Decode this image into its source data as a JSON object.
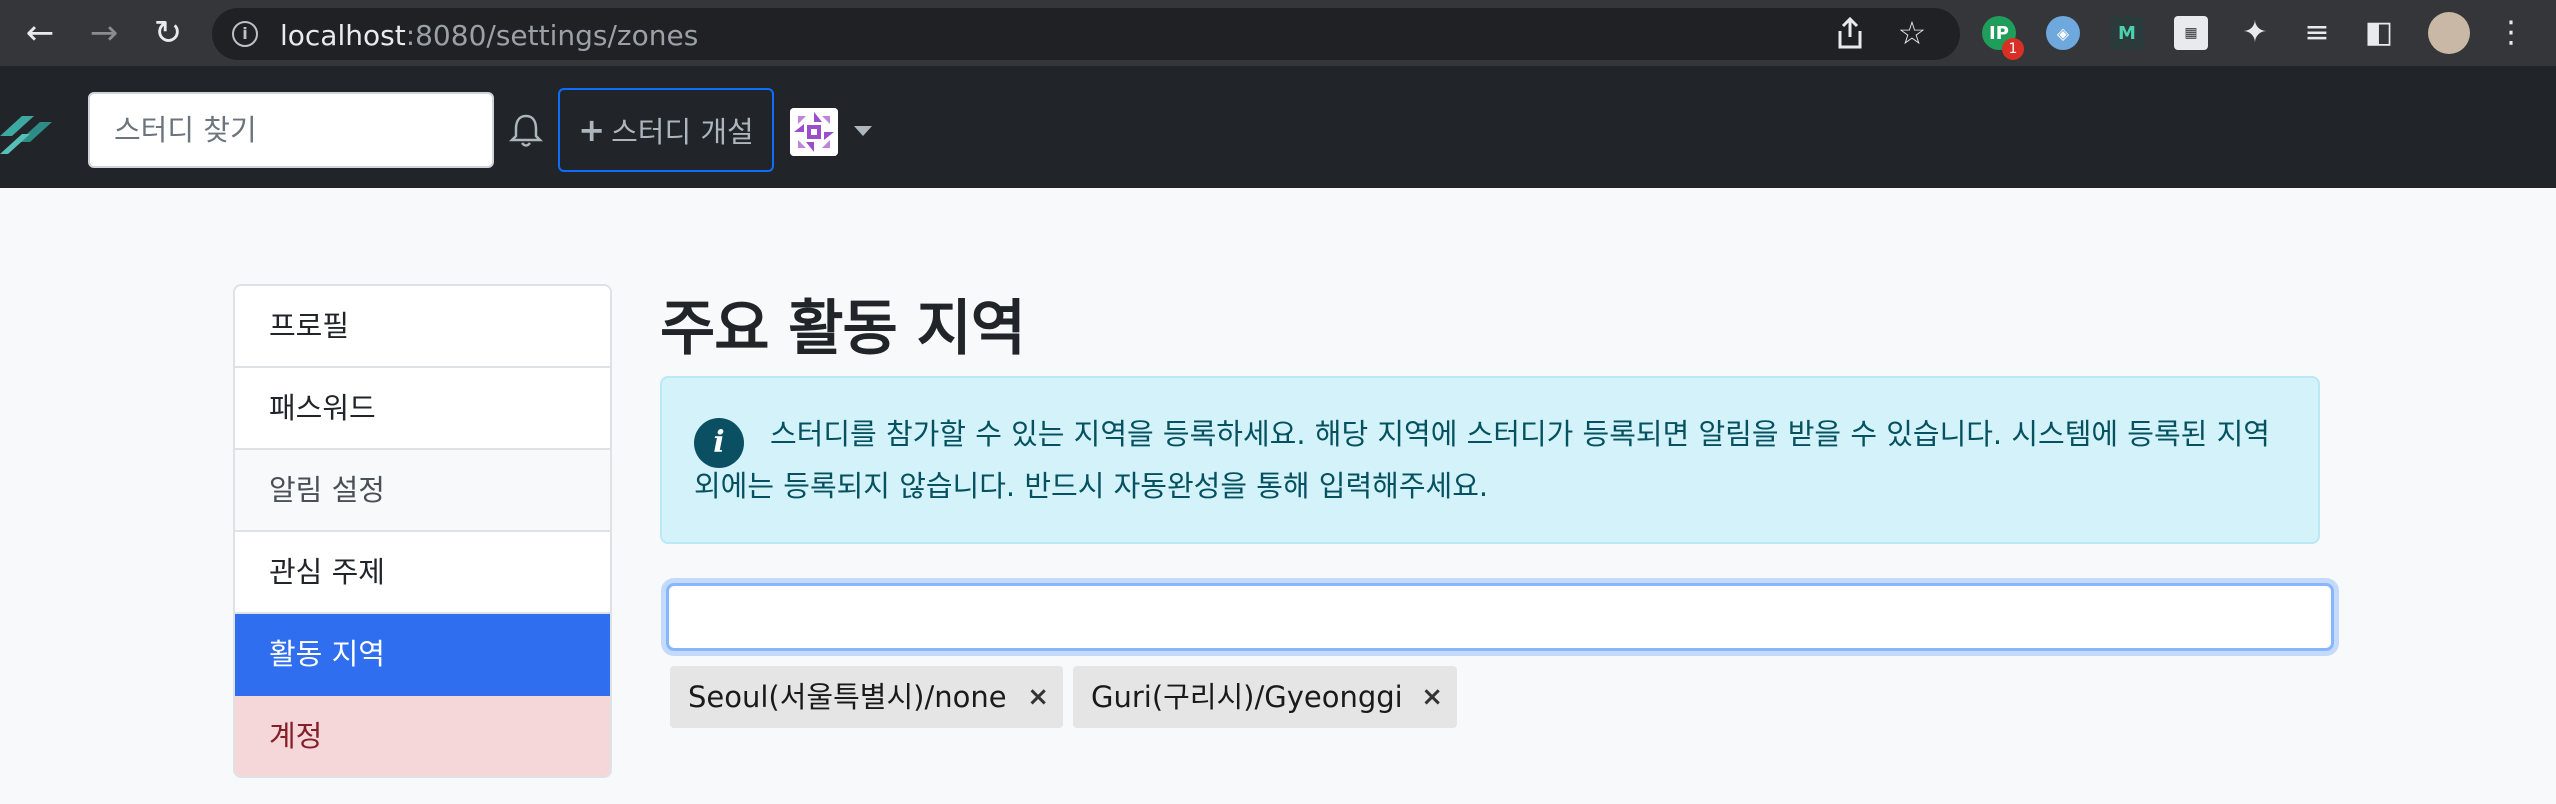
{
  "browser": {
    "url_host": "localhost",
    "url_path": ":8080/settings/zones",
    "extension_badge": "1"
  },
  "navbar": {
    "search_placeholder": "스터디 찾기",
    "create_label": "스터디 개설"
  },
  "sidebar": {
    "items": [
      {
        "label": "프로필"
      },
      {
        "label": "패스워드"
      },
      {
        "label": "알림 설정"
      },
      {
        "label": "관심 주제"
      },
      {
        "label": "활동 지역"
      },
      {
        "label": "계정"
      }
    ]
  },
  "main": {
    "title": "주요 활동 지역",
    "alert_text": "스터디를 참가할 수 있는 지역을 등록하세요. 해당 지역에 스터디가 등록되면 알림을 받을 수 있습니다. 시스템에 등록된 지역 외에는 등록되지 않습니다. 반드시 자동완성을 통해 입력해주세요.",
    "zone_input_value": "",
    "tags": [
      {
        "label": "Seoul(서울특별시)/none",
        "remove": "×"
      },
      {
        "label": "Guri(구리시)/Gyeonggi",
        "remove": "×"
      }
    ]
  },
  "colors": {
    "navbar_bg": "#212529",
    "active": "#2f6fef",
    "alert_bg": "#d3f2f9",
    "danger_bg": "#f5d6d9"
  }
}
